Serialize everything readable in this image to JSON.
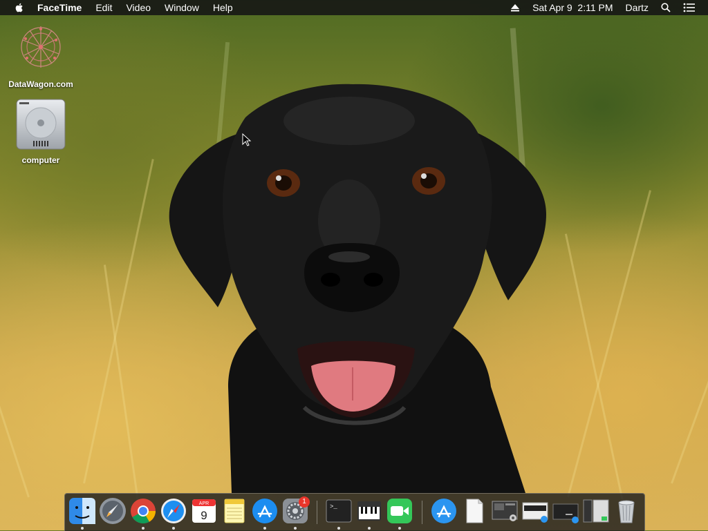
{
  "menubar": {
    "app_name": "FaceTime",
    "menus": [
      "Edit",
      "Video",
      "Window",
      "Help"
    ],
    "datetime": "Sat Apr 9  2:11 PM",
    "user": "Dartz"
  },
  "desktop": {
    "icons": [
      {
        "label": "DataWagon.com"
      },
      {
        "label": "computer"
      }
    ]
  },
  "dock": {
    "apps": [
      "Finder",
      "Launchpad",
      "Google Chrome",
      "Safari",
      "Calendar",
      "Notes",
      "App Store",
      "System Preferences",
      "Terminal",
      "Piano",
      "FaceTime",
      "App Store",
      "Documents",
      "Screenshot",
      "Screenshot",
      "Window",
      "Window",
      "Trash"
    ],
    "calendar_month": "APR",
    "calendar_day": "9",
    "badge_count": "1"
  },
  "colors": {
    "menubar_bg": "#141414",
    "badge": "#e9352b"
  }
}
